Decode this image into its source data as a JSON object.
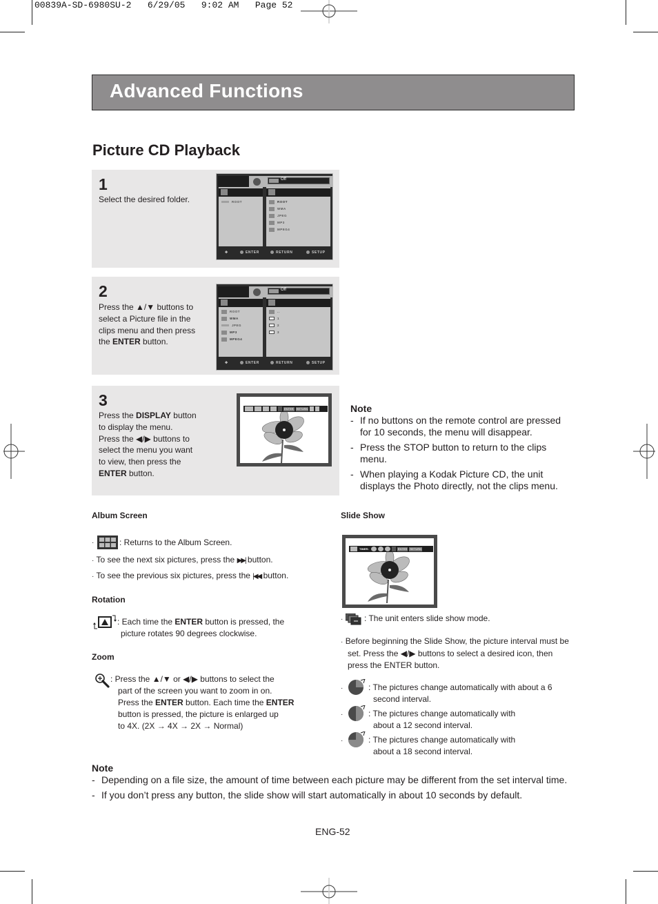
{
  "print_header": "00839A-SD-6980SU-2   6/29/05   9:02 AM   Page 52",
  "banner_title": "Advanced Functions",
  "section_title": "Picture CD Playback",
  "steps": [
    {
      "number": "1",
      "lines": [
        "Select the desired folder."
      ]
    },
    {
      "number": "2",
      "line1_pre": "Press the ",
      "line1_sym": "▲/▼",
      "line1_post": " buttons to",
      "line2": "select a Picture file in the",
      "line3": "clips menu and then press",
      "line4_pre": "the ",
      "line4_bold": "ENTER",
      "line4_post": " button."
    },
    {
      "number": "3",
      "line1_pre": "Press the ",
      "line1_bold": "DISPLAY",
      "line1_post": " button",
      "line2": "to display the menu.",
      "line3_pre": "Press the ",
      "line3_sym": "◀/▶",
      "line3_post": " buttons to",
      "line4": "select the menu you want",
      "line5": "to view, then press the",
      "line6_bold": "ENTER",
      "line6_post": " button."
    }
  ],
  "osd_menu_1": {
    "repeat_value": "Off",
    "left_items": [
      "ROOT"
    ],
    "right_items": [
      "ROOT",
      "WMA",
      "JPEG",
      "MP3",
      "MPEG4"
    ],
    "bottom": {
      "enter": "ENTER",
      "return": "RETURN",
      "setup": "SETUP"
    }
  },
  "osd_menu_2": {
    "repeat_value": "Off",
    "left_items": [
      "ROOT",
      "WMA",
      "JPEG",
      "MP3",
      "MPEG4"
    ],
    "right_items": [
      "..",
      "1",
      "2",
      "3"
    ],
    "bottom": {
      "enter": "ENTER",
      "return": "RETURN",
      "setup": "SETUP"
    }
  },
  "picture_toolbar": {
    "enter": "ENTER",
    "return": "RETURN"
  },
  "slideshow_toolbar": {
    "timer": "TIMER:",
    "enter": "ENTER",
    "return": "RETURN"
  },
  "note_top": {
    "title": "Note",
    "items": [
      "If no buttons on the remote control are pressed for 10 seconds, the menu will disappear.",
      "Press the STOP button to return to the clips menu.",
      "When playing a Kodak Picture CD, the unit displays the Photo directly, not the clips menu."
    ]
  },
  "album_screen": {
    "heading": "Album Screen",
    "item1": ": Returns to the Album Screen.",
    "item2_pre": "To see the next six pictures, press the ",
    "item2_post": " button.",
    "item3_pre": "To see the previous six pictures, press the ",
    "item3_post": " button."
  },
  "rotation": {
    "heading": "Rotation",
    "line1_pre": ": Each time the ",
    "line1_bold": "ENTER",
    "line1_post": " button is pressed, the",
    "line2": "picture rotates 90 degrees clockwise."
  },
  "zoom": {
    "heading": "Zoom",
    "line1_pre": ": Press the ",
    "line1_sym1": "▲/▼",
    "line1_mid": " or ",
    "line1_sym2": "◀/▶",
    "line1_post": " buttons to select the",
    "line2": "part of the screen you want to zoom in on.",
    "line3_pre": "Press the ",
    "line3_bold1": "ENTER",
    "line3_mid": " button. Each time the ",
    "line3_bold2": "ENTER",
    "line4": "button is pressed, the picture is enlarged up",
    "line5": "to 4X. (2X → 4X → 2X → Normal)"
  },
  "slide_show": {
    "heading": "Slide Show",
    "item1": ": The unit enters slide show mode.",
    "item2_l1": "Before beginning the Slide Show, the picture interval must be",
    "item2_l2_pre": "set. Press the ",
    "item2_l2_sym": "◀/▶",
    "item2_l2_post": " buttons to select a desired icon, then",
    "item2_l3": "press the ENTER button.",
    "intervals": [
      {
        "l1": ": The pictures change automatically with about a 6",
        "l2": "second interval.",
        "fraction": 0.25
      },
      {
        "l1": ": The pictures change automatically with",
        "l2": "about a 12 second interval.",
        "fraction": 0.5
      },
      {
        "l1": ": The pictures change automatically with",
        "l2": "about a 18 second interval.",
        "fraction": 0.75
      }
    ]
  },
  "note_bottom": {
    "title": "Note",
    "items": [
      "Depending on a file size, the amount of time between each picture may be different from the set interval time.",
      "If you don’t press any button, the slide show will start automatically in about 10 seconds by default."
    ]
  },
  "page_number": "ENG-52",
  "colors": {
    "banner_bg": "#8f8d8e",
    "step_bg": "#e8e7e7",
    "text": "#231f20"
  }
}
